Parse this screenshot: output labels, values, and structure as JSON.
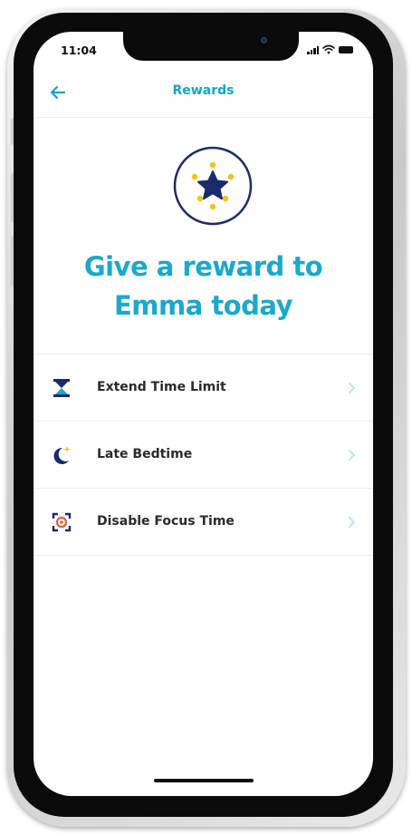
{
  "status_bar": {
    "time": "11:04"
  },
  "nav": {
    "title": "Rewards",
    "back_icon": "arrow-left-icon"
  },
  "hero": {
    "badge_icon": "star-badge-icon",
    "headline_line1": "Give a reward to",
    "headline_line2": "Emma today"
  },
  "rewards": [
    {
      "label": "Extend Time Limit",
      "icon": "hourglass-icon"
    },
    {
      "label": "Late Bedtime",
      "icon": "moon-star-icon"
    },
    {
      "label": "Disable Focus Time",
      "icon": "focus-target-icon"
    }
  ],
  "colors": {
    "accent": "#19a9cb",
    "navy": "#1b2a6b",
    "yellow": "#f2c318",
    "orange_red": "#ec5a3a",
    "divider": "#e6f3f6",
    "chevron": "#bfe4ee"
  }
}
